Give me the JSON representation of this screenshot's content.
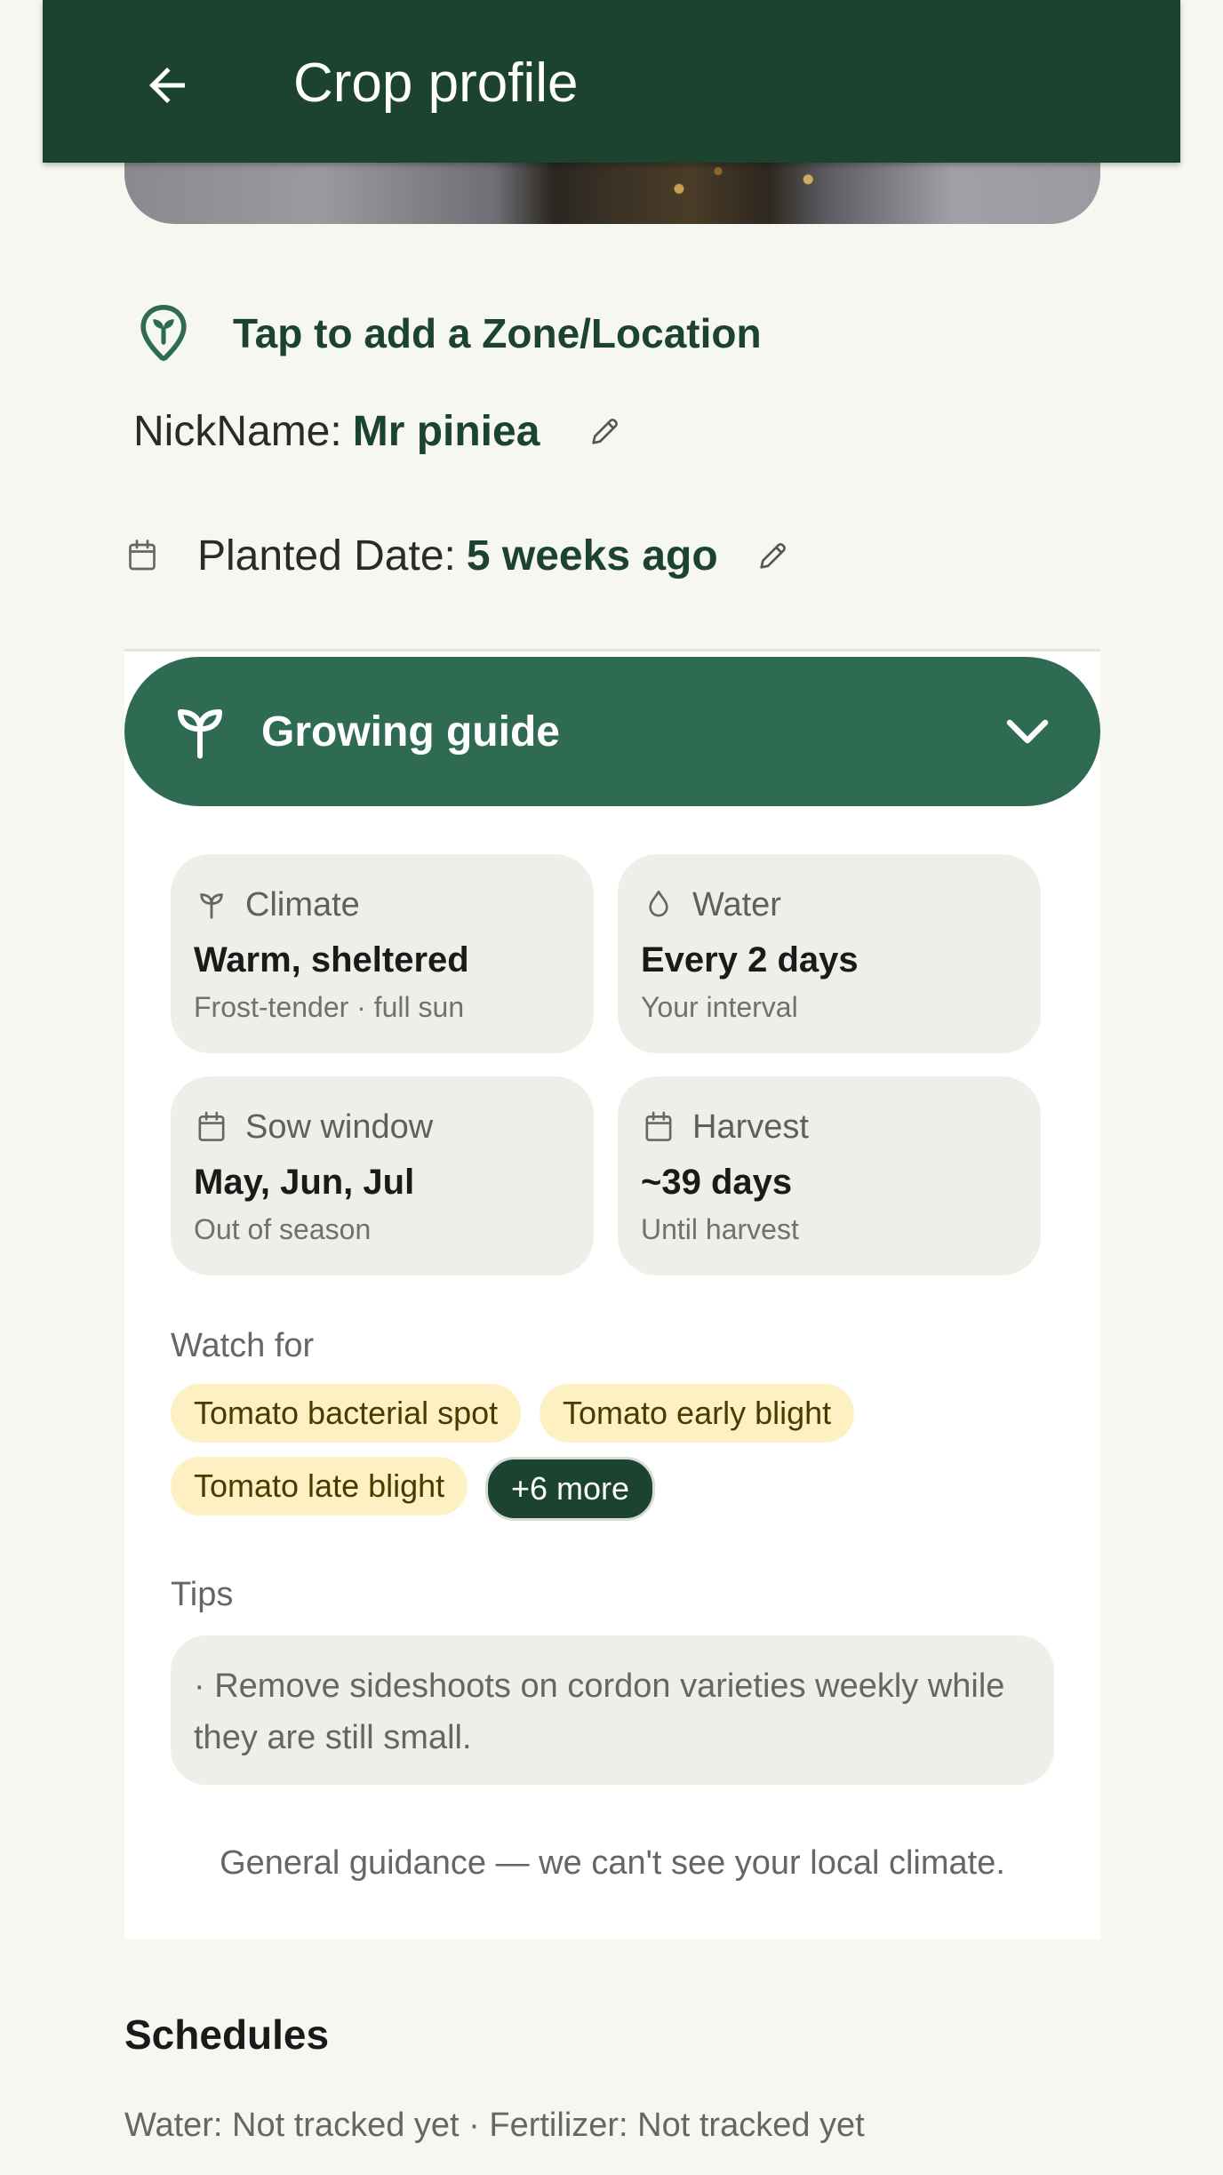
{
  "app_bar": {
    "title": "Crop profile",
    "back_icon": "arrow-left-icon",
    "background": "#1c4230"
  },
  "location": {
    "label": "Tap to add a Zone/Location",
    "icon": "location-sprout-pin-icon"
  },
  "nickname": {
    "key": "NickName:",
    "value": "Mr piniea",
    "edit_icon": "pencil-icon"
  },
  "planted": {
    "key": "Planted Date:",
    "value": "5 weeks ago",
    "icon": "calendar-icon",
    "edit_icon": "pencil-icon"
  },
  "guide": {
    "title": "Growing guide",
    "icon": "sprout-icon",
    "expand_icon": "chevron-down-icon",
    "accent": "#2e6b52",
    "tiles": [
      {
        "name": "Climate",
        "value": "Warm, sheltered",
        "sub": "Frost-tender · full sun",
        "icon": "sprout-icon"
      },
      {
        "name": "Water",
        "value": "Every 2 days",
        "sub": "Your interval",
        "icon": "droplet-icon"
      },
      {
        "name": "Sow window",
        "value": "May, Jun, Jul",
        "sub": "Out of season",
        "icon": "calendar-icon"
      },
      {
        "name": "Harvest",
        "value": "~39 days",
        "sub": "Until harvest",
        "icon": "calendar-icon"
      }
    ],
    "watch_for_label": "Watch for",
    "watch_for": [
      "Tomato bacterial spot",
      "Tomato early blight",
      "Tomato late blight"
    ],
    "more_label": "+6 more",
    "tips_label": "Tips",
    "tip": "· Remove sideshoots on cordon varieties weekly while they are still small.",
    "footnote": "General guidance — we can't see your local climate."
  },
  "schedules": {
    "title": "Schedules",
    "text": "Water: Not tracked yet · Fertilizer: Not tracked yet"
  }
}
